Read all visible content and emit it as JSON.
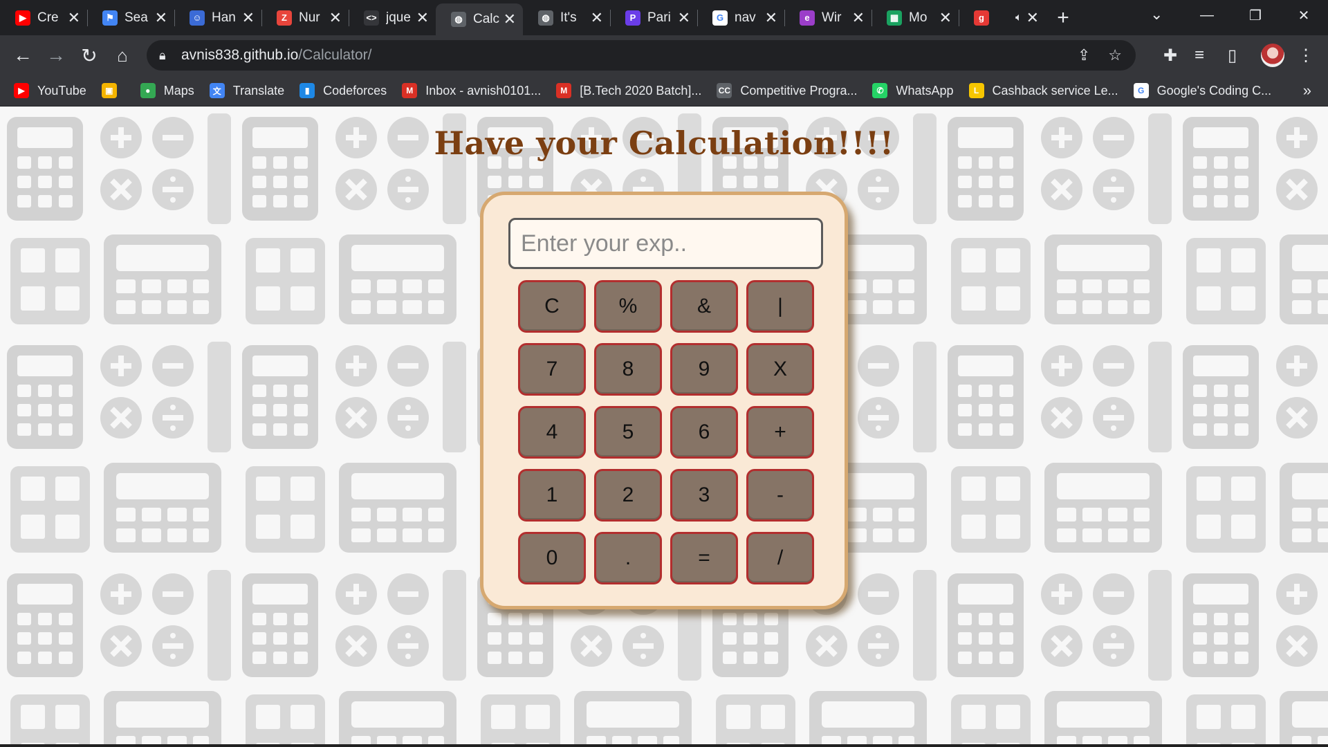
{
  "browser": {
    "tabs": [
      {
        "title": "Cre",
        "favicon": "youtube-icon",
        "color": "#ff0000",
        "glyph": "▶"
      },
      {
        "title": "Sea",
        "favicon": "flag-icon",
        "color": "#4285f4",
        "glyph": "⚑"
      },
      {
        "title": "Han",
        "favicon": "robot-icon",
        "color": "#3b6bd6",
        "glyph": "☺"
      },
      {
        "title": "Nur",
        "favicon": "zoho-icon",
        "color": "#e8453c",
        "glyph": "Z"
      },
      {
        "title": "jque",
        "favicon": "code-icon",
        "color": "#35363a",
        "glyph": "<>"
      },
      {
        "title": "Calc",
        "favicon": "globe-icon",
        "color": "#5f6368",
        "glyph": "◍",
        "active": true
      },
      {
        "title": "It's",
        "favicon": "globe-icon",
        "color": "#5f6368",
        "glyph": "◍"
      },
      {
        "title": "Pari",
        "favicon": "pari-icon",
        "color": "#6a3de8",
        "glyph": "P"
      },
      {
        "title": "nav",
        "favicon": "google-icon",
        "color": "#ffffff",
        "glyph": "G"
      },
      {
        "title": "Wir",
        "favicon": "edge-icon",
        "color": "#9b3ec9",
        "glyph": "e"
      },
      {
        "title": "Mo",
        "favicon": "sheets-icon",
        "color": "#1aa260",
        "glyph": "▦"
      },
      {
        "title": "",
        "favicon": "g-red-icon",
        "color": "#e53935",
        "glyph": "g",
        "audio": true
      }
    ],
    "tab_close": "✕",
    "new_tab": "+",
    "url_host": "avnis838.github.io",
    "url_path": "/Calculator/",
    "bookmarks": [
      {
        "label": "YouTube",
        "icon": "youtube-icon",
        "color": "#ff0000",
        "glyph": "▶"
      },
      {
        "label": "",
        "icon": "contacts-icon",
        "color": "#f4b400",
        "glyph": "▣"
      },
      {
        "label": "Maps",
        "icon": "maps-icon",
        "color": "#34a853",
        "glyph": "●"
      },
      {
        "label": "Translate",
        "icon": "translate-icon",
        "color": "#4285f4",
        "glyph": "文"
      },
      {
        "label": "Codeforces",
        "icon": "codeforces-icon",
        "color": "#1e88e5",
        "glyph": "▮"
      },
      {
        "label": "Inbox - avnish0101...",
        "icon": "gmail-icon",
        "color": "#d93025",
        "glyph": "M"
      },
      {
        "label": "[B.Tech 2020 Batch]...",
        "icon": "gmail-icon",
        "color": "#d93025",
        "glyph": "M"
      },
      {
        "label": "Competitive Progra...",
        "icon": "cc-icon",
        "color": "#5f6368",
        "glyph": "CC"
      },
      {
        "label": "WhatsApp",
        "icon": "whatsapp-icon",
        "color": "#25d366",
        "glyph": "✆"
      },
      {
        "label": "Cashback service Le...",
        "icon": "cashback-icon",
        "color": "#f7c600",
        "glyph": "L"
      },
      {
        "label": "Google's Coding C...",
        "icon": "google-icon",
        "color": "#ffffff",
        "glyph": "G"
      }
    ],
    "bookmarks_more": "»"
  },
  "page": {
    "heading": "Have your Calculation!!!!",
    "display_placeholder": "Enter your exp..",
    "keys": [
      "C",
      "%",
      "&",
      "|",
      "7",
      "8",
      "9",
      "X",
      "4",
      "5",
      "6",
      "+",
      "1",
      "2",
      "3",
      "-",
      "0",
      ".",
      "=",
      "/"
    ],
    "colors": {
      "heading": "#7b3f12",
      "key": "#867466",
      "key_border": "#b22e2e",
      "panel": "#fae9d6",
      "panel_border": "#d6a870"
    }
  }
}
